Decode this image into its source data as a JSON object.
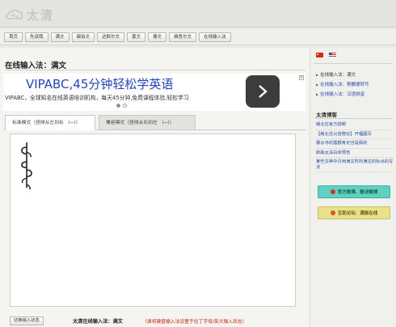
{
  "site": {
    "logo_text": "太清",
    "logo_icon": "cloud-icon"
  },
  "nav": {
    "items": [
      "首页",
      "先读我",
      "满文",
      "锡伯文",
      "达斡尔文",
      "蒙文",
      "傣文",
      "维吾尔文",
      "在线输入法"
    ]
  },
  "main": {
    "title": "在线输入法：满文"
  },
  "ad": {
    "headline": "VIPABC,45分钟轻松学英语",
    "body": "VIPABC，全球知名在线英语培训机构，每天45分钟,免费课程体验,轻松学习",
    "arrow_icon": "chevron-right-icon",
    "close_icon": "close-icon"
  },
  "tabs": [
    {
      "label": "标准模式（竖排从左到右　i—i）",
      "active": true
    },
    {
      "label": "兼容模式（竖排从右到左　i—i）",
      "active": false
    }
  ],
  "editor": {
    "content_description_icon": "manchu-vertical-text"
  },
  "bottom": {
    "switch_button": "切换输入状态",
    "label": "太清在线输入法：满文",
    "warning": "（请将键盘输入法设置于拉丁字母/英文输入状态）"
  },
  "sidebar": {
    "flags": [
      "china-flag-icon",
      "us-flag-icon"
    ],
    "links": [
      {
        "label": "在线输入法：满文",
        "current": true
      },
      {
        "label": "在线输入法：穆麟德转写",
        "current": false
      },
      {
        "label": "在线输入法：汉语拼音",
        "current": false
      }
    ],
    "blog_title": "太清博客",
    "blog_items": [
      "赣北任官方视频",
      "【赣北任公自赠仪】开幅图页",
      "娜云寺的露额肯定也是假的",
      "新版太清白体预告",
      "某些文种中引用满文时的满文的标点的写法"
    ],
    "weibo_button": "官方微博、歌诗微博",
    "forum_button": "互助论坛：满族在线"
  },
  "colors": {
    "ad_headline": "#2445b8",
    "warning": "#c8201a",
    "link": "#2a48a8",
    "weibo_bg": "#5fd1c1",
    "forum_bg": "#e9e28c"
  }
}
